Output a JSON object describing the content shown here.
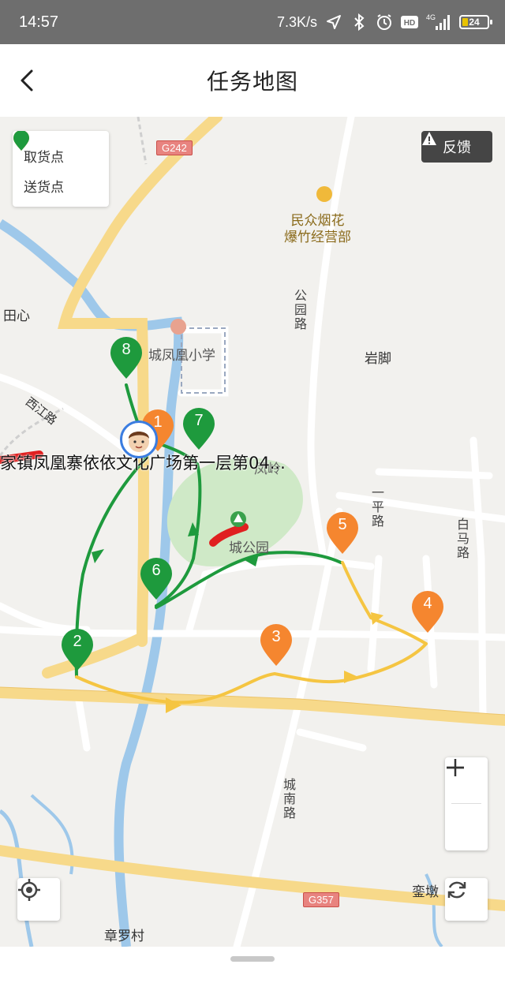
{
  "status_bar": {
    "time": "14:57",
    "net_speed": "7.3K/s",
    "signal_type": "4G",
    "battery": "24",
    "icons": [
      "location-arrow-icon",
      "bluetooth-icon",
      "alarm-icon",
      "hd-icon",
      "signal-icon",
      "battery-icon"
    ]
  },
  "header": {
    "title": "任务地图",
    "back_icon": "back-arrow-icon"
  },
  "legend": {
    "pickup_label": "取货点",
    "delivery_label": "送货点",
    "pickup_color": "#f5862f",
    "delivery_color": "#1e9a3d"
  },
  "feedback": {
    "label": "反馈",
    "icon": "warning-icon"
  },
  "map_labels": {
    "place_tianxin": "田心",
    "place_yanjiao": "岩脚",
    "place_zhangluocun": "章罗村",
    "place_luandun": "銮墩",
    "poi_fireworks_line1": "民众烟花",
    "poi_fireworks_line2": "爆竹经营部",
    "school": "城凤凰小学",
    "park": "城公园",
    "road_gongyuan": "公园路",
    "road_xijiang": "西江路",
    "road_yiping": "一平路",
    "road_baima": "白马路",
    "road_chengnan": "城南路",
    "highway_g242": "G242",
    "highway_g357": "G357",
    "place_fengjia": "凤岭"
  },
  "address_label": "家镇凤凰寨依依文化广场第一层第04...",
  "markers": [
    {
      "num": "1",
      "type": "pickup"
    },
    {
      "num": "2",
      "type": "delivery"
    },
    {
      "num": "3",
      "type": "pickup"
    },
    {
      "num": "4",
      "type": "pickup"
    },
    {
      "num": "5",
      "type": "pickup"
    },
    {
      "num": "6",
      "type": "delivery"
    },
    {
      "num": "7",
      "type": "delivery"
    },
    {
      "num": "8",
      "type": "delivery"
    }
  ],
  "route_colors": {
    "green": "#1e9a3d",
    "yellow": "#f5c542"
  },
  "controls": {
    "zoom_in": "+",
    "zoom_out": "−",
    "locate_icon": "locate-crosshair-icon",
    "refresh_icon": "refresh-icon"
  }
}
